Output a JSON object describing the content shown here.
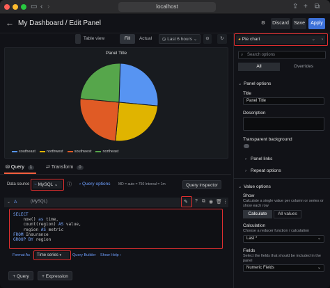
{
  "browser": {
    "url": "localhost"
  },
  "header": {
    "title": "My Dashboard / Edit Panel",
    "discard_label": "Discard",
    "save_label": "Save",
    "apply_label": "Apply"
  },
  "toolbar": {
    "table_view_label": "Table view",
    "fill_label": "Fill",
    "actual_label": "Actual",
    "time_range_label": "Last 6 hours"
  },
  "panel": {
    "title": "Panel Title",
    "legend": [
      {
        "name": "southeast",
        "color": "#5794f2"
      },
      {
        "name": "northwest",
        "color": "#e0b400"
      },
      {
        "name": "southwest",
        "color": "#e05b25"
      },
      {
        "name": "northeast",
        "color": "#56a64b"
      }
    ]
  },
  "chart_data": {
    "type": "pie",
    "title": "Panel Title",
    "categories": [
      "southeast",
      "northwest",
      "southwest",
      "northeast"
    ],
    "values": [
      26,
      25,
      25,
      24
    ]
  },
  "query_tabs": {
    "query_label": "Query",
    "query_count": "1",
    "transform_label": "Transform",
    "transform_count": "0"
  },
  "datasource": {
    "label": "Data source",
    "value": "MySQL",
    "query_options_label": "Query options",
    "query_options_meta": "MD = auto = 750   Interval = 1m",
    "inspector_label": "Query inspector"
  },
  "query": {
    "ref": "A",
    "source": "(MySQL)",
    "sql_lines": [
      "SELECT",
      "    now() as time,",
      "    count(region) AS value,",
      "    region AS metric",
      "FROM Insurance",
      "GROUP BY region"
    ],
    "format_as_label": "Format As",
    "format_value": "Time series",
    "query_builder_label": "Query Builder",
    "show_help_label": "Show Help"
  },
  "actions": {
    "add_query_label": "Query",
    "add_expression_label": "Expression"
  },
  "options": {
    "viz_name": "Pie chart",
    "search_placeholder": "Search options",
    "tab_all": "All",
    "tab_overrides": "Overrides",
    "panel_options_label": "Panel options",
    "title_label": "Title",
    "title_value": "Panel Title",
    "description_label": "Description",
    "transparent_label": "Transparent background",
    "panel_links_label": "Panel links",
    "repeat_options_label": "Repeat options",
    "value_options_label": "Value options",
    "show_label": "Show",
    "show_desc": "Calculate a single value per column or series or show each row",
    "calculate_label": "Calculate",
    "all_values_label": "All values",
    "calculation_label": "Calculation",
    "calculation_desc": "Choose a reducer function / calculation",
    "calculation_value": "Last *",
    "fields_label": "Fields",
    "fields_desc": "Select the fields that should be included in the panel",
    "fields_value": "Numeric Fields"
  }
}
